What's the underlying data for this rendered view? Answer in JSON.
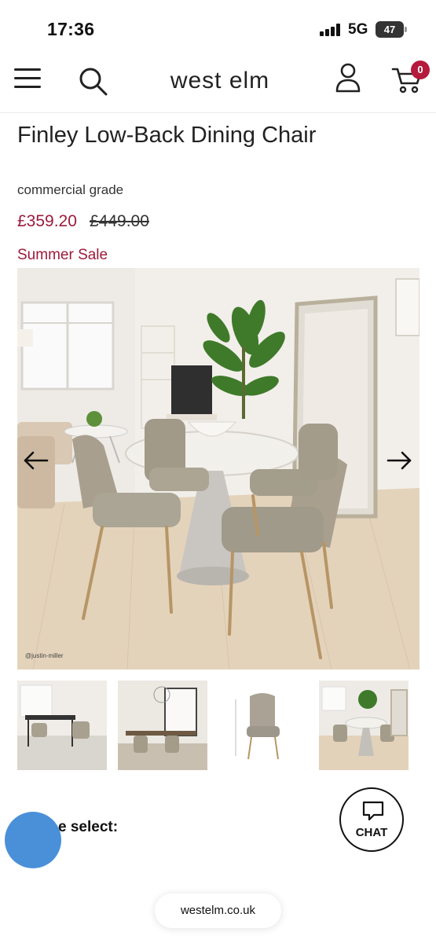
{
  "status_bar": {
    "time": "17:36",
    "network": "5G",
    "battery": "47"
  },
  "header": {
    "brand": "west elm",
    "cart_count": "0",
    "icons": [
      "menu-icon",
      "search-icon",
      "account-icon",
      "cart-icon"
    ]
  },
  "product": {
    "title": "Finley Low-Back Dining Chair",
    "grade": "commercial grade",
    "sale_price": "£359.20",
    "original_price": "£449.00",
    "sale_label": "Summer Sale",
    "image_credit": "@justin-miller",
    "thumbnail_count": 4
  },
  "options": {
    "select_label": "e select:"
  },
  "chat": {
    "label": "CHAT"
  },
  "browser": {
    "url": "westelm.co.uk"
  },
  "colors": {
    "accent": "#9b1b3b",
    "badge": "#b5193c",
    "chat_fab": "#4a90d9",
    "text": "#222222"
  }
}
